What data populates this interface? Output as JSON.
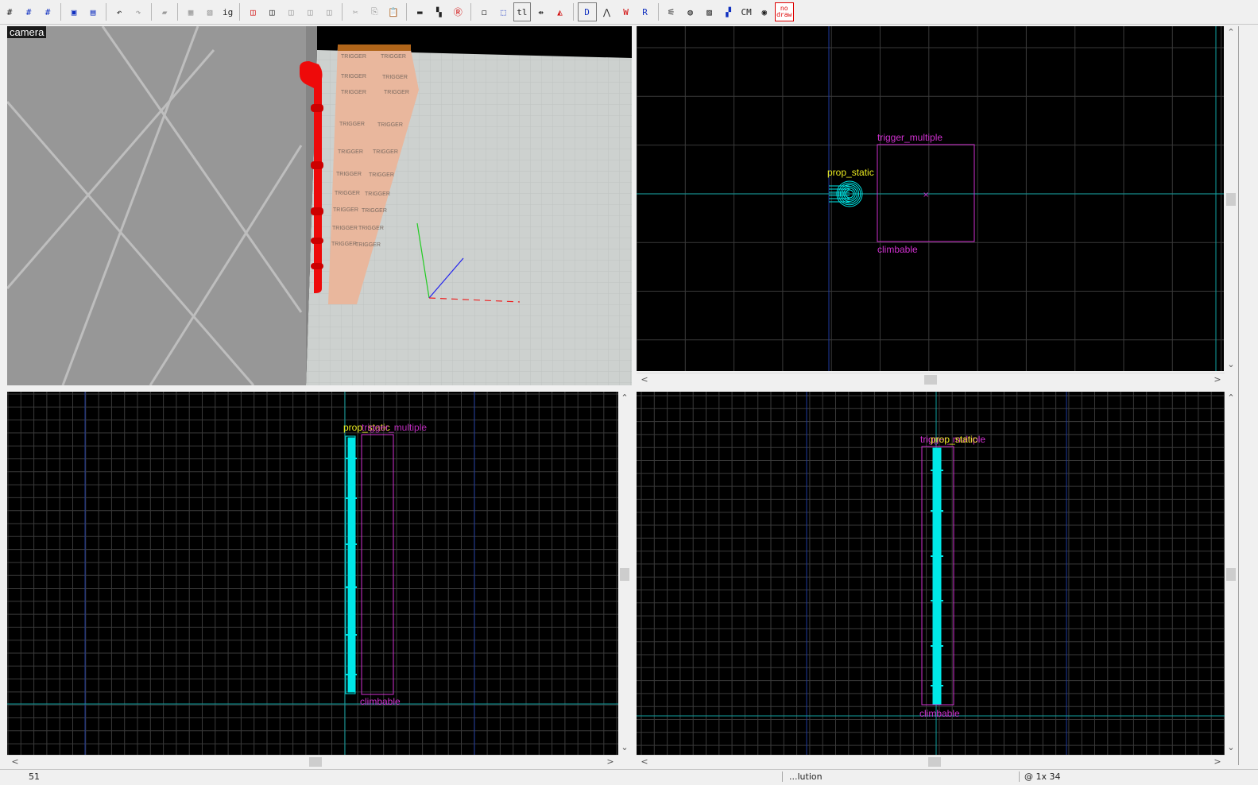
{
  "toolbar": {
    "buttons": [
      {
        "name": "grid-toggle-icon",
        "glyph": "#",
        "cls": ""
      },
      {
        "name": "grid-smaller-icon",
        "glyph": "#",
        "cls": "blue"
      },
      {
        "name": "grid-larger-icon",
        "glyph": "#",
        "cls": "blue"
      },
      {
        "name": "sep"
      },
      {
        "name": "carve-icon",
        "glyph": "▣",
        "cls": "blue"
      },
      {
        "name": "group-icon",
        "glyph": "▤",
        "cls": "blue"
      },
      {
        "name": "sep"
      },
      {
        "name": "undo-icon",
        "glyph": "↶",
        "cls": ""
      },
      {
        "name": "redo-icon",
        "glyph": "↷",
        "cls": "grey"
      },
      {
        "name": "sep"
      },
      {
        "name": "paste-special-icon",
        "glyph": "▰",
        "cls": "grey"
      },
      {
        "name": "sep"
      },
      {
        "name": "hide-icon",
        "glyph": "▦",
        "cls": "grey"
      },
      {
        "name": "unhide-icon",
        "glyph": "▧",
        "cls": "grey"
      },
      {
        "name": "ignore-groups-label",
        "glyph": "ig",
        "cls": "lbl"
      },
      {
        "name": "sep"
      },
      {
        "name": "selection-red-icon",
        "glyph": "◫",
        "cls": "red"
      },
      {
        "name": "selection-copy-icon",
        "glyph": "◫",
        "cls": ""
      },
      {
        "name": "selection-paste-icon",
        "glyph": "◫",
        "cls": "grey"
      },
      {
        "name": "selection-extra-icon",
        "glyph": "◫",
        "cls": "grey"
      },
      {
        "name": "selection-more-icon",
        "glyph": "◫",
        "cls": "grey"
      },
      {
        "name": "sep"
      },
      {
        "name": "cut-icon",
        "glyph": "✂",
        "cls": "grey"
      },
      {
        "name": "copy-icon",
        "glyph": "⎘",
        "cls": "grey"
      },
      {
        "name": "paste-icon",
        "glyph": "📋",
        "cls": ""
      },
      {
        "name": "sep"
      },
      {
        "name": "toggle-helpers-icon",
        "glyph": "▬",
        "cls": ""
      },
      {
        "name": "toggle-models-icon",
        "glyph": "▚",
        "cls": ""
      },
      {
        "name": "radius-culling-icon",
        "glyph": "Ⓡ",
        "cls": "red"
      },
      {
        "name": "sep"
      },
      {
        "name": "texture-lock-icon",
        "glyph": "◻",
        "cls": ""
      },
      {
        "name": "select-by-handles-icon",
        "glyph": "⬚",
        "cls": "blue"
      },
      {
        "name": "texture-lock-label",
        "glyph": "tl",
        "cls": "lbl box"
      },
      {
        "name": "scale-texture-lock-icon",
        "glyph": "⇹",
        "cls": ""
      },
      {
        "name": "texture-application-icon",
        "glyph": "◭",
        "cls": "red"
      },
      {
        "name": "sep"
      },
      {
        "name": "cordon-icon",
        "glyph": "D",
        "cls": "blue box"
      },
      {
        "name": "3d-mode-icon",
        "glyph": "⋀",
        "cls": ""
      },
      {
        "name": "wireframe-icon",
        "glyph": "W",
        "cls": "red"
      },
      {
        "name": "display-mode-icon",
        "glyph": "R",
        "cls": "blue"
      },
      {
        "name": "sep"
      },
      {
        "name": "smoothing-icon",
        "glyph": "⚟",
        "cls": ""
      },
      {
        "name": "sphere-icon",
        "glyph": "◍",
        "cls": ""
      },
      {
        "name": "displacement-icon",
        "glyph": "▨",
        "cls": ""
      },
      {
        "name": "vis-group-icon",
        "glyph": "▞",
        "cls": "blue"
      },
      {
        "name": "cubemap-label",
        "glyph": "CM",
        "cls": "lbl"
      },
      {
        "name": "leaf-icon",
        "glyph": "◉",
        "cls": ""
      },
      {
        "name": "nodraw-icon",
        "glyph": "no draw",
        "cls": "nodraw"
      }
    ]
  },
  "viewports": {
    "camera": {
      "label": "camera"
    },
    "top": {
      "labels": {
        "trigger": "trigger_multiple",
        "prop": "prop_static",
        "bottom": "climbable"
      }
    },
    "front": {
      "labels": {
        "overlap_a": "prop_static",
        "overlap_b": "trigger_multiple",
        "bottom": "climbable"
      }
    },
    "side": {
      "labels": {
        "overlap_a": "trigger_multiple",
        "overlap_b": "prop_static",
        "bottom": "climbable"
      }
    }
  },
  "texture": {
    "word": "TRIGGER"
  },
  "status": {
    "left": "51",
    "mid": "...lution",
    "right": "@ 1x 34"
  },
  "colors": {
    "grid": "#444444",
    "grid_major": "#1e3a9e",
    "axis": "#10a0a0",
    "entity": "#d030d0",
    "prop": "#00e8e8",
    "label_yellow": "#e8e820"
  }
}
